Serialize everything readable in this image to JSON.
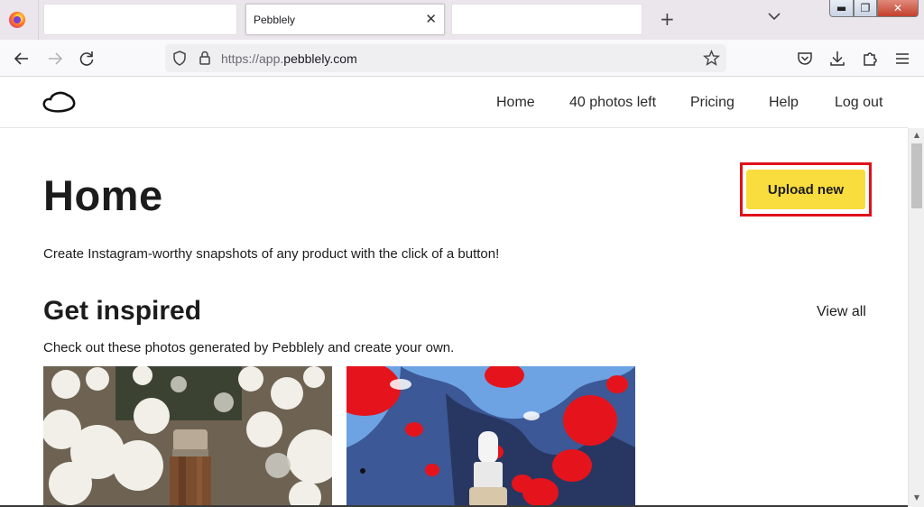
{
  "browser": {
    "tabs": [
      {
        "label": ""
      },
      {
        "label": "Pebblely",
        "active": true
      },
      {
        "label": ""
      }
    ],
    "url_prefix": "https://app.",
    "url_domain": "pebblely.com",
    "icons": [
      "firefox-icon",
      "close-tab-icon",
      "new-tab-icon",
      "tab-list-icon",
      "back-icon",
      "forward-icon",
      "reload-icon",
      "shield-icon",
      "lock-icon",
      "bookmark-star-icon",
      "pocket-icon",
      "download-icon",
      "extensions-icon",
      "menu-icon"
    ]
  },
  "site": {
    "nav": [
      "Home",
      "40 photos left",
      "Pricing",
      "Help",
      "Log out"
    ]
  },
  "main": {
    "title": "Home",
    "upload_label": "Upload new",
    "tagline": "Create Instagram-worthy snapshots of any product with the click of a button!",
    "inspired_title": "Get inspired",
    "view_all": "View all",
    "inspired_sub": "Check out these photos generated by Pebblely and create your own."
  },
  "colors": {
    "accent": "#f9dc3d",
    "highlight_frame": "#e0101a",
    "text": "#1c1c1c"
  }
}
